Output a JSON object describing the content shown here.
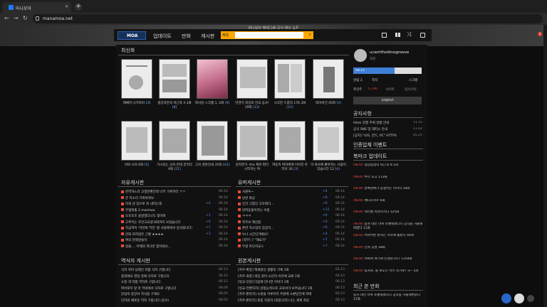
{
  "browser": {
    "tab_title": "마나모아",
    "url": "manamoa.net"
  },
  "notice": "마나모아 텔레그램 공식 채널 오픈",
  "nav": {
    "logo_text": "MOA",
    "items": [
      "업데이트",
      "만화",
      "게시판"
    ],
    "search_select": "제목",
    "badge_count": "3"
  },
  "latest": {
    "title": "최신화",
    "row1": [
      {
        "title": "재채하 나가타비",
        "n": "1화"
      },
      {
        "title": "생강의한의 야근과 4-1화",
        "n": "[8]"
      },
      {
        "title": "짝사랑 스크랩 1, 2화",
        "n": "[9]"
      },
      {
        "title": "만엔가 최강의 한교 음사! 19화",
        "n": "[33]"
      },
      {
        "title": "시크한 드롭직 176.3화",
        "n": "[25]"
      },
      {
        "title": "데이비건 45화",
        "n": "[4]"
      }
    ],
    "row2": [
      {
        "title": "비와 나의 6화",
        "n": "[5]"
      },
      {
        "title": "가시있는 상처 반대 분리다 9화",
        "n": "[21]"
      },
      {
        "title": "그의 결혼안내 35화",
        "n": "[43]"
      },
      {
        "title": "감자면가 -the 제로 편다 시작하는 여",
        "n": ""
      },
      {
        "title": "여동족 여자애에 이어진 마리아 30",
        "n": "[3]"
      },
      {
        "title": "이 회사에 좋아하는 사람이 있습니다 12",
        "n": "[4]"
      }
    ]
  },
  "free_board": {
    "title": "자유게시판",
    "rows": [
      {
        "t": "번역하느라 고생한편안테 너무 가혹하다 ㅜㅜ",
        "d": "06.14",
        "c": ""
      },
      {
        "t": "큰 목소리 가위바위보",
        "d": "06.14",
        "c": ""
      },
      {
        "t": "자게 글 맞으로 죽 내리는데",
        "d": "06.14",
        "c": "+4"
      },
      {
        "t": "무협외출 2.manhwa",
        "d": "06.14",
        "c": ""
      },
      {
        "t": "오호호호 용량형더니도 찾아와",
        "d": "06.14",
        "c": "+1"
      },
      {
        "t": "고추먹는 조인고교생 8화까지 보았습니다",
        "d": "06.14",
        "c": "+4"
      },
      {
        "t": "지금까지 '아만화 키친' 볼 사람에게서 감사합니다!",
        "d": "06.14",
        "c": "+1"
      },
      {
        "t": "만화 까지않은 근황 ★★★★",
        "d": "06.14",
        "c": "+3"
      },
      {
        "t": "여의 만화원들이",
        "d": "06.14",
        "c": ""
      },
      {
        "t": "방울.... 이제의 히나만 찾아와요...",
        "d": "06.14",
        "c": ""
      }
    ]
  },
  "humor_board": {
    "title": "유머게시판",
    "rows": [
      {
        "t": "사원투~",
        "d": "06.14",
        "c": "+4"
      },
      {
        "t": "날씬 화공",
        "d": "06.14",
        "c": "+8"
      },
      {
        "t": "인간 그룹인 고유화다...",
        "d": "06.14",
        "c": "+6"
      },
      {
        "t": "반려동물이라는 이름",
        "d": "06.14",
        "c": "+11"
      },
      {
        "t": "ㅋㅋㅋ",
        "d": "06.14",
        "c": "+6"
      },
      {
        "t": "족주보 제산합",
        "d": "06.14",
        "c": "+4"
      },
      {
        "t": "촌반 목소일의 갑갑이...",
        "d": "06.14",
        "c": "+6"
      },
      {
        "t": "누나 시간인가베요?",
        "d": "06.14",
        "c": "+4"
      },
      {
        "t": "(약부) 7 \"해요가\"",
        "d": "06.14",
        "c": "+1"
      },
      {
        "t": "무량 아모치교스",
        "d": "06.14",
        "c": "+7"
      }
    ]
  },
  "translator_board": {
    "title": "역식자 게시판",
    "rows": [
      {
        "t": "식자 하며 상태인 작품 식자 구합니다",
        "d": "06.13"
      },
      {
        "t": "중대에요 영업 장에 식자로 구합니다",
        "d": "06.12"
      },
      {
        "t": "소정 게 작품 역자로 구합니다",
        "d": "06.11"
      },
      {
        "t": "파바로지 앞 마 역의에서 식자로 구합니다",
        "d": "06.06"
      },
      {
        "t": "문답의 중앙서 역식을 구해요",
        "d": "06.05"
      },
      {
        "t": "단하의 예로운 역자 구합니다 (응모)",
        "d": "06.05"
      }
    ]
  },
  "request_board": {
    "title": "원본게시판",
    "rows": [
      {
        "t": "[자주-확장] 액세원산 생활의 기록 1화",
        "d": "06.13"
      },
      {
        "t": "[자주-표준] 게임 원이 소년의 이뮤에 교류 1화",
        "d": "06.13"
      },
      {
        "t": "[일교-단원] 다음에 만나면 이야기 1화",
        "d": "06.13"
      },
      {
        "t": "[일교-전편타지] 감정능력으로 고로서가 보주습니다 1화",
        "d": "06.13"
      },
      {
        "t": "[자주-판타지] 소원을 이루어지 주원에 소환받은에 저에",
        "d": "06.13"
      },
      {
        "t": "[자주-판타지] 최종 지원자 [최종식자] 나는 세계 최강",
        "d": "06.13"
      }
    ]
  },
  "sidebar": {
    "username": "ucanttholdnogroove",
    "user_sub": "회원",
    "level_label": "58.15",
    "level_fraction": 0.6,
    "stats": [
      "알림 3",
      "쪽지",
      "스크랩"
    ],
    "points_label": "포인트",
    "points_value": "5,790",
    "meta_right": [
      "0/0회",
      "접속/0일"
    ],
    "logout": "Logout",
    "notice_title": "공지사항",
    "notices": [
      {
        "t": "hitmi 검열 주회 방법 안내",
        "d": "11.15"
      },
      {
        "t": "공식 SNS 및 대피소 안내",
        "d": "11.02"
      },
      {
        "t": "[공지] \"iOS, 안드, PC\" HTTPS",
        "d": "05.21"
      }
    ],
    "certify_title": "인증업체 이벤트",
    "bookmark_title": "북마크 업데이트",
    "bookmarks": [
      "생강탐정의 야근과 4-1화",
      "누나 포고 113화",
      "알록달록가 동생이는 이이이 34화",
      "배니즈미르 6화",
      "워터월 마찬타시다 125화",
      "동사 데신 미위 토빨해졌다니 공작을 거물해버렸다 11화",
      "어마어른 판사는 억하례 출판다 44화",
      "인사 공명 18화",
      "어쩌서 여기에 인생님 017 1354화",
      "동사로, 를 로도는 아르 산가로? 3~ 1화"
    ],
    "recent_title": "최근 본 만화",
    "recent": [
      "동사 데신 미위 토빨해졌다니 공작을 거물해버렸다 11화"
    ]
  },
  "colors": {
    "accent": "#ffa600",
    "link": "#4a90ff",
    "bullet": "#e84b3a",
    "level_bar": "#3f7fd6"
  }
}
